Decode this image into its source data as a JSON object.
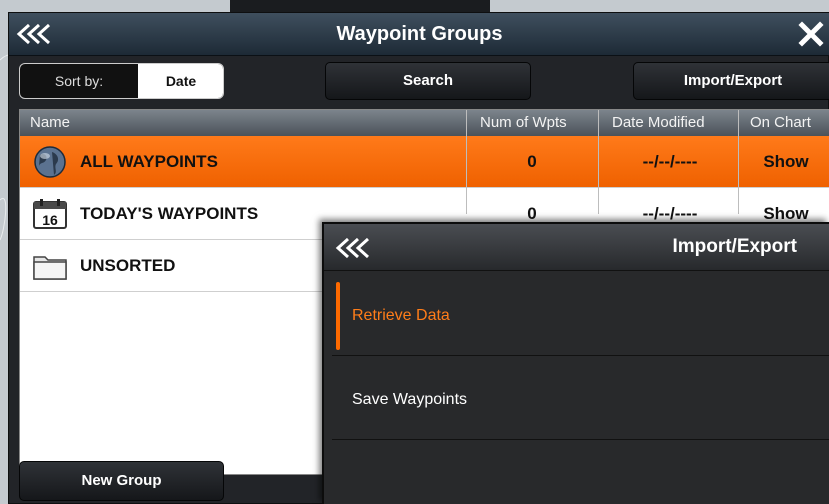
{
  "window": {
    "title": "Waypoint Groups"
  },
  "toolbar": {
    "sort_label": "Sort by:",
    "sort_value": "Date",
    "search_label": "Search",
    "import_export_label": "Import/Export",
    "new_group_label": "New Group"
  },
  "table": {
    "columns": [
      "Name",
      "Num of Wpts",
      "Date Modified",
      "On Chart"
    ],
    "rows": [
      {
        "name": "ALL WAYPOINTS",
        "num": "0",
        "date": "--/--/----",
        "on_chart": "Show",
        "icon": "globe-icon",
        "selected": true
      },
      {
        "name": "TODAY'S WAYPOINTS",
        "num": "0",
        "date": "--/--/----",
        "on_chart": "Show",
        "icon": "calendar-icon",
        "calendar_day": "16"
      },
      {
        "name": "UNSORTED",
        "icon": "folder-icon"
      }
    ]
  },
  "panel": {
    "title": "Import/Export",
    "items": [
      {
        "label": "Retrieve Data",
        "active": true
      },
      {
        "label": "Save Waypoints"
      }
    ]
  },
  "colors": {
    "accent": "#ff6a00",
    "selected_row": "#f26a0a",
    "titlebar": "#2b3a48"
  }
}
